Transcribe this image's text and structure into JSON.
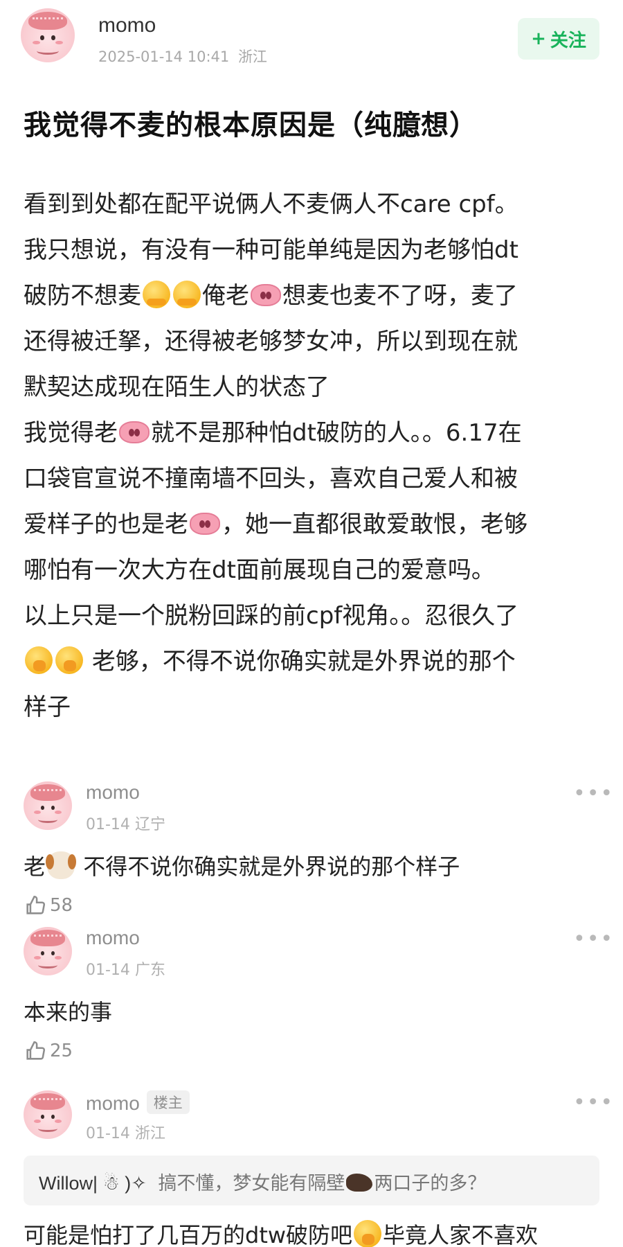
{
  "post": {
    "author": "momo",
    "timestamp": "2025-01-14 10:41",
    "location": "浙江",
    "follow_label": "关注",
    "title": "我觉得不麦的根本原因是（纯臆想）",
    "lines": {
      "l1": "看到到处都在配平说俩人不麦俩人不care cpf。",
      "l2": "我只想说，有没有一种可能单纯是因为老够怕dt",
      "l3a": "破防不想麦",
      "l3b": "俺老",
      "l3c": "想麦也麦不了呀，麦了",
      "l4": "还得被迁拏，还得被老够梦女冲，所以到现在就",
      "l5": "默契达成现在陌生人的状态了",
      "l6a": "我觉得老",
      "l6b": "就不是那种怕dt破防的人。。6.17在",
      "l7": "口袋官宣说不撞南墙不回头，喜欢自己爱人和被",
      "l8a": "爱样子的也是老",
      "l8b": "，她一直都很敢爱敢恨，老够",
      "l9": "哪怕有一次大方在dt面前展现自己的爱意吗。",
      "l10": "以上只是一个脱粉回踩的前cpf视角。。忍很久了",
      "l11": "老够，不得不说你确实就是外界说的那个",
      "l12": "样子"
    }
  },
  "comments": [
    {
      "author": "momo",
      "date": "01-14",
      "location": "辽宁",
      "text_prefix": "老",
      "text_suffix": "不得不说你确实就是外界说的那个样子",
      "likes": "58"
    },
    {
      "author": "momo",
      "date": "01-14",
      "location": "广东",
      "text": "本来的事",
      "likes": "25"
    },
    {
      "author": "momo",
      "badge": "楼主",
      "date": "01-14",
      "location": "浙江",
      "quote_user": "Willow| ☃ )✧",
      "quote_text_a": "搞不懂，梦女能有隔壁",
      "quote_text_b": "两口子的多？",
      "text_a": "可能是怕打了几百万的dtw破防吧",
      "text_b": "毕竟人家不喜欢"
    }
  ],
  "ui": {
    "more": "•••",
    "accent_color": "#19b35b"
  },
  "icons": [
    "plus-icon",
    "thumbs-up-icon",
    "more-dots-icon",
    "hug-emoji-icon",
    "pig-nose-emoji-icon",
    "shush-emoji-icon",
    "dog-emoji-icon",
    "boar-emoji-icon"
  ]
}
